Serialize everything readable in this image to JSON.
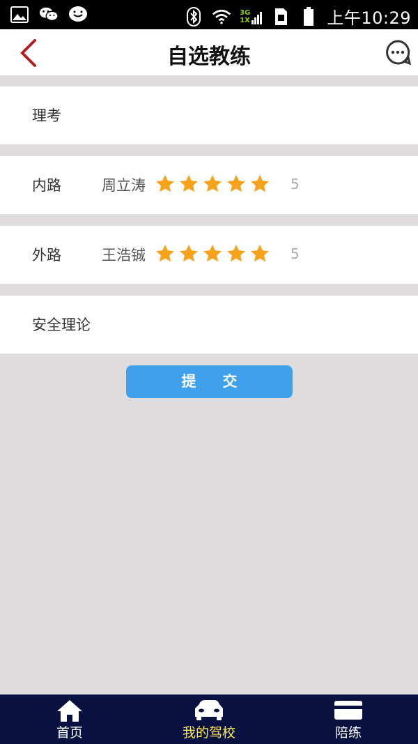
{
  "status_bar": {
    "time": "上午10:29",
    "network_top": "3G",
    "network_bottom": "1X"
  },
  "header": {
    "title": "自选教练"
  },
  "rows": [
    {
      "label": "理考"
    },
    {
      "label": "内路",
      "coach": "周立涛",
      "rating": 5,
      "score": "5"
    },
    {
      "label": "外路",
      "coach": "王浩铖",
      "rating": 5,
      "score": "5"
    },
    {
      "label": "安全理论"
    }
  ],
  "submit": {
    "label": "提交"
  },
  "bottom_nav": {
    "items": [
      {
        "label": "首页",
        "icon": "home-icon"
      },
      {
        "label": "我的驾校",
        "icon": "car-icon",
        "active": true
      },
      {
        "label": "陪练",
        "icon": "card-icon"
      }
    ]
  },
  "colors": {
    "star": "#f7a21b",
    "submit": "#3fa0ec",
    "nav_bg": "#081140",
    "nav_active": "#ffe94a",
    "back_arrow": "#b01e1e"
  }
}
